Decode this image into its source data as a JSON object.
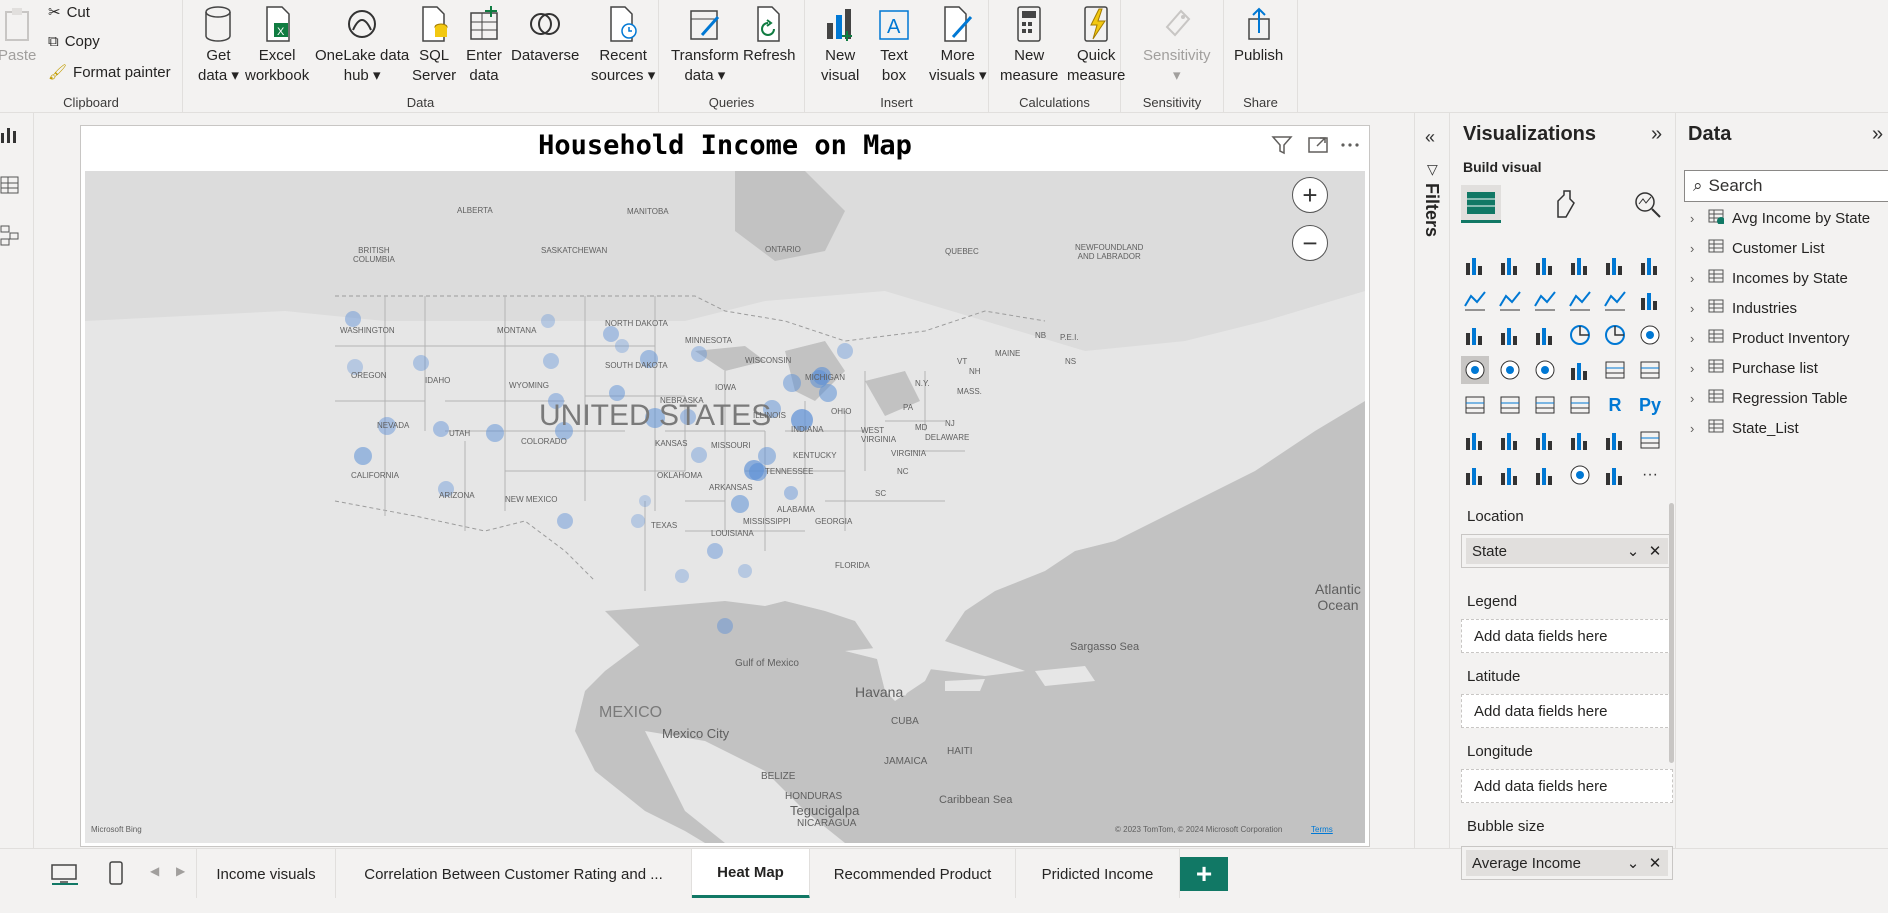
{
  "ribbon": {
    "clipboard": {
      "label": "Clipboard",
      "paste": "Paste",
      "cut": "Cut",
      "copy": "Copy",
      "format_painter": "Format painter"
    },
    "data": {
      "label": "Data",
      "get_data": "Get\ndata ▾",
      "excel": "Excel\nworkbook",
      "onelake": "OneLake data\nhub ▾",
      "sql": "SQL\nServer",
      "enter_data": "Enter\ndata",
      "dataverse": "Dataverse",
      "recent": "Recent\nsources ▾"
    },
    "queries": {
      "label": "Queries",
      "transform": "Transform\ndata ▾",
      "refresh": "Refresh"
    },
    "insert": {
      "label": "Insert",
      "new_visual": "New\nvisual",
      "text_box": "Text\nbox",
      "more_visuals": "More\nvisuals ▾"
    },
    "calculations": {
      "label": "Calculations",
      "new_measure": "New\nmeasure",
      "quick_measure": "Quick\nmeasure"
    },
    "sensitivity": {
      "label": "Sensitivity",
      "button": "Sensitivity\n▾"
    },
    "share": {
      "label": "Share",
      "publish": "Publish"
    }
  },
  "visual": {
    "title": "Household Income on Map",
    "map_labels": {
      "country_us": "UNITED STATES",
      "mexico": "MEXICO",
      "mexico_city": "Mexico City",
      "havana": "Havana",
      "cuba": "CUBA",
      "jamaica": "JAMAICA",
      "haiti": "HAITI",
      "belize": "BELIZE",
      "honduras": "HONDURAS",
      "tegucigalpa": "Tegucigalpa",
      "nicaragua": "NICARAGUA",
      "gulf": "Gulf of Mexico",
      "caribbean": "Caribbean Sea",
      "sargasso": "Sargasso Sea",
      "atlantic": "Atlantic\nOcean",
      "bc": "BRITISH\nCOLUMBIA",
      "alberta": "ALBERTA",
      "sask": "SASKATCHEWAN",
      "manitoba": "MANITOBA",
      "ontario": "ONTARIO",
      "quebec": "QUEBEC",
      "nfl": "NEWFOUNDLAND\nAND LABRADOR",
      "nb": "NB",
      "pei": "P.E.I.",
      "ns": "NS",
      "states": [
        "WASHINGTON",
        "OREGON",
        "CALIFORNIA",
        "NEVADA",
        "IDAHO",
        "MONTANA",
        "WYOMING",
        "UTAH",
        "ARIZONA",
        "COLORADO",
        "NEW MEXICO",
        "NORTH DAKOTA",
        "SOUTH DAKOTA",
        "NEBRASKA",
        "KANSAS",
        "OKLAHOMA",
        "TEXAS",
        "MINNESOTA",
        "IOWA",
        "MISSOURI",
        "ARKANSAS",
        "LOUISIANA",
        "WISCONSIN",
        "ILLINOIS",
        "MICHIGAN",
        "INDIANA",
        "OHIO",
        "KENTUCKY",
        "TENNESSEE",
        "MISSISSIPPI",
        "ALABAMA",
        "GEORGIA",
        "FLORIDA",
        "SC",
        "NC",
        "VIRGINIA",
        "WEST\nVIRGINIA",
        "PA",
        "N.Y.",
        "MAINE",
        "VT",
        "NH",
        "MASS.",
        "NJ",
        "MD",
        "DELAWARE"
      ],
      "attribution_left": "Microsoft Bing",
      "attribution_right": "© 2023 TomTom, © 2024 Microsoft Corporation",
      "terms": "Terms"
    }
  },
  "tabs": {
    "pages": [
      "Income visuals",
      "Correlation Between Customer Rating and ...",
      "Heat Map",
      "Recommended Product",
      "Pridicted Income"
    ],
    "active_index": 2,
    "add": "+"
  },
  "filters": {
    "label": "Filters"
  },
  "visualizations": {
    "title": "Visualizations",
    "build": "Build visual",
    "wells": {
      "location": {
        "label": "Location",
        "value": "State"
      },
      "legend": {
        "label": "Legend",
        "placeholder": "Add data fields here"
      },
      "latitude": {
        "label": "Latitude",
        "placeholder": "Add data fields here"
      },
      "longitude": {
        "label": "Longitude",
        "placeholder": "Add data fields here"
      },
      "bubble": {
        "label": "Bubble size",
        "value": "Average Income"
      }
    },
    "more": "···",
    "r_label": "R",
    "py_label": "Py"
  },
  "data_pane": {
    "title": "Data",
    "search_placeholder": "Search",
    "tables": [
      "Avg Income by State",
      "Customer List",
      "Incomes by State",
      "Industries",
      "Product Inventory",
      "Purchase list",
      "Regression Table",
      "State_List"
    ]
  }
}
